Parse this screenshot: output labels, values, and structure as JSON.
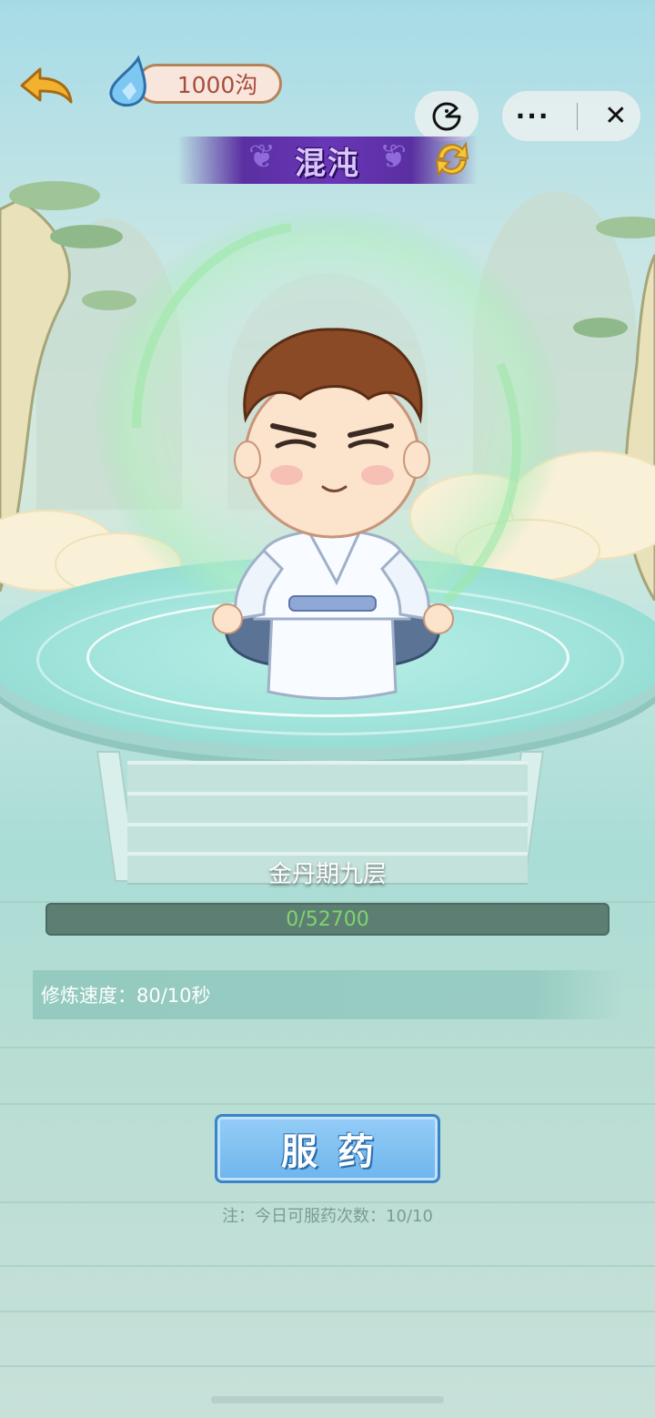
{
  "header": {
    "currency_amount": "1000沟",
    "banner_title": "混沌"
  },
  "cultivation": {
    "level_name": "金丹期九层",
    "progress_text": "0/52700",
    "progress_fraction": 0,
    "speed_text": "修炼速度：80/10秒"
  },
  "action": {
    "take_medicine_label": "服药",
    "note_text": "注：今日可服药次数：10/10"
  },
  "icons": {
    "back": "back-arrow-icon",
    "currency": "water-drop-icon",
    "swap": "refresh-icon",
    "mini_game": "pacman-icon",
    "more": "more-icon",
    "close": "close-icon"
  },
  "colors": {
    "banner": "#6a36b8",
    "button": "#6eb5ec",
    "progress_track": "#5d7f73",
    "progress_text": "#7ed56b"
  }
}
